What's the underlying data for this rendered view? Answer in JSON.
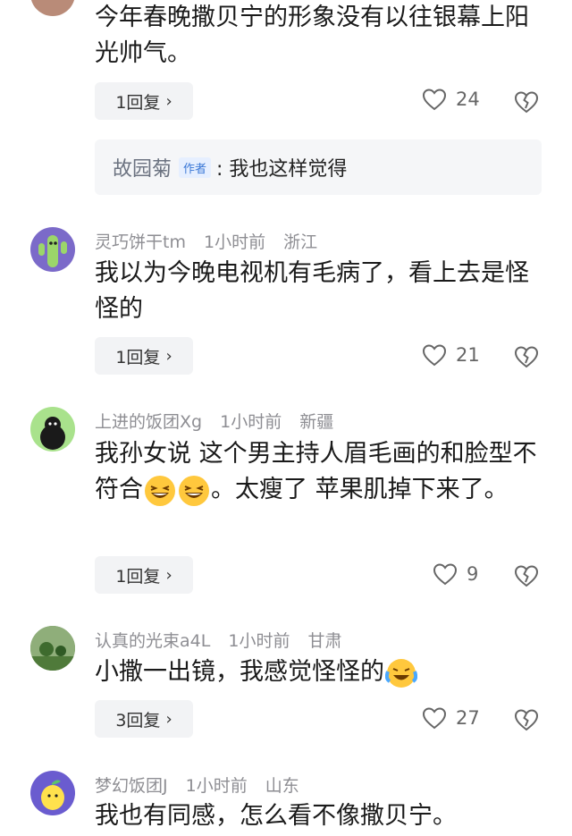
{
  "comments": [
    {
      "text": "今年春晚撒贝宁的形象没有以往银幕上阳光帅气。",
      "reply_label": "1回复",
      "likes": "24",
      "sub_reply": {
        "name": "故园菊",
        "tag": "作者",
        "text": ": 我也这样觉得"
      }
    },
    {
      "user": "灵巧饼干tm",
      "time": "1小时前",
      "location": "浙江",
      "text": "我以为今晚电视机有毛病了，看上去是怪怪的",
      "reply_label": "1回复",
      "likes": "21"
    },
    {
      "user": "上进的饭团Xg",
      "time": "1小时前",
      "location": "新疆",
      "text_a": "我孙女说 这个男主持人眉毛画的和脸型不符合",
      "text_b": "。太瘦了 苹果肌掉下来了。",
      "reply_label": "1回复",
      "likes": "9"
    },
    {
      "user": "认真的光束a4L",
      "time": "1小时前",
      "location": "甘肃",
      "text": "小撒一出镜，我感觉怪怪的",
      "reply_label": "3回复",
      "likes": "27"
    },
    {
      "user": "梦幻饭团J",
      "time": "1小时前",
      "location": "山东",
      "text": "我也有同感，怎么看不像撒贝宁。"
    }
  ]
}
